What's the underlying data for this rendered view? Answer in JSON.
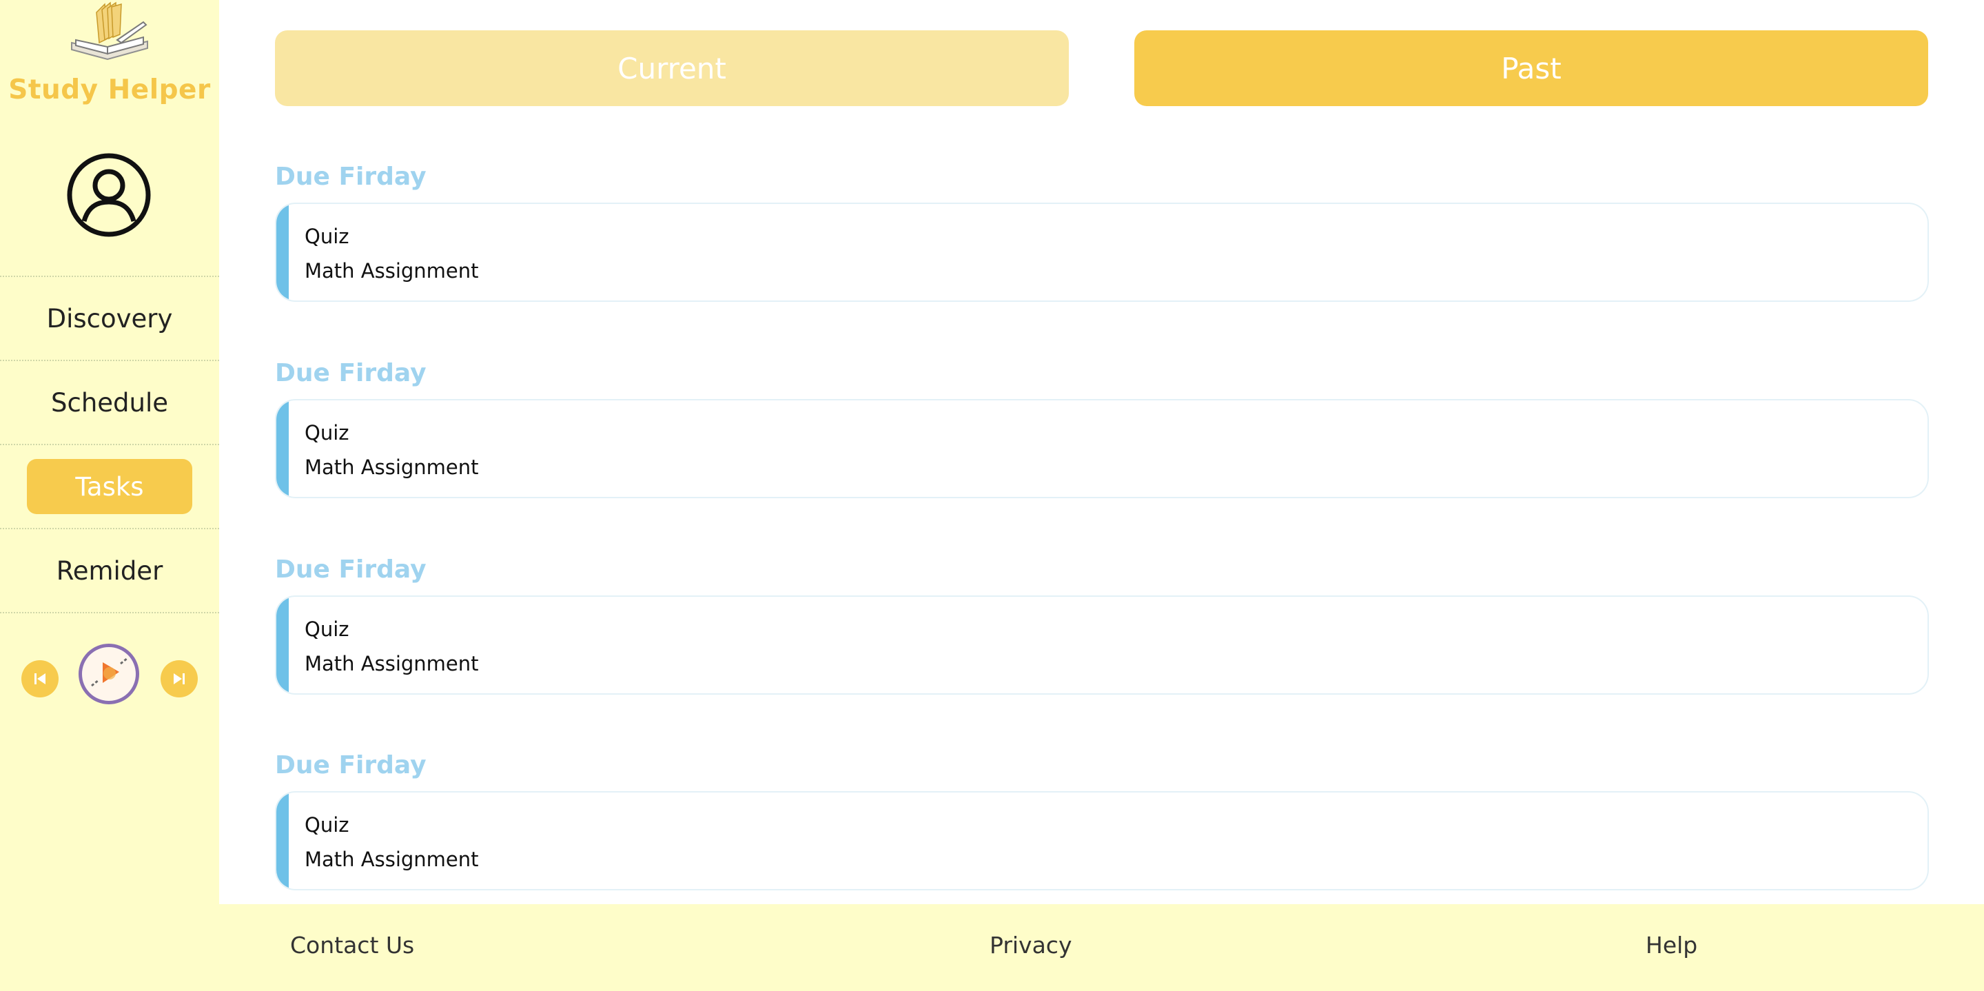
{
  "app": {
    "title": "Study Helper",
    "logo_icon": "open-book-icon"
  },
  "sidebar": {
    "avatar_icon": "user-avatar-icon",
    "items": [
      {
        "label": "Discovery",
        "active": false
      },
      {
        "label": "Schedule",
        "active": false
      },
      {
        "label": "Tasks",
        "active": true
      },
      {
        "label": "Remider",
        "active": false
      }
    ],
    "player": {
      "prev_icon": "skip-previous-icon",
      "disc_icon": "music-disc-icon",
      "next_icon": "skip-next-icon"
    }
  },
  "tabs": [
    {
      "label": "Current",
      "selected": false
    },
    {
      "label": "Past",
      "selected": true
    }
  ],
  "groups": [
    {
      "label": "Due Firday",
      "tasks": [
        "Quiz",
        "Math Assignment"
      ]
    },
    {
      "label": "Due Firday",
      "tasks": [
        "Quiz",
        "Math Assignment"
      ]
    },
    {
      "label": "Due Firday",
      "tasks": [
        "Quiz",
        "Math Assignment"
      ]
    },
    {
      "label": "Due Firday",
      "tasks": [
        "Quiz",
        "Math Assignment"
      ]
    }
  ],
  "footer": {
    "links": [
      "Contact Us",
      "Privacy",
      "Help"
    ]
  },
  "colors": {
    "sidebar_bg": "#fefdc9",
    "accent_yellow": "#f7cb4d",
    "tab_inactive": "#f9e6a2",
    "group_label": "#9fd3ef",
    "card_accent": "#6ec1e8"
  }
}
